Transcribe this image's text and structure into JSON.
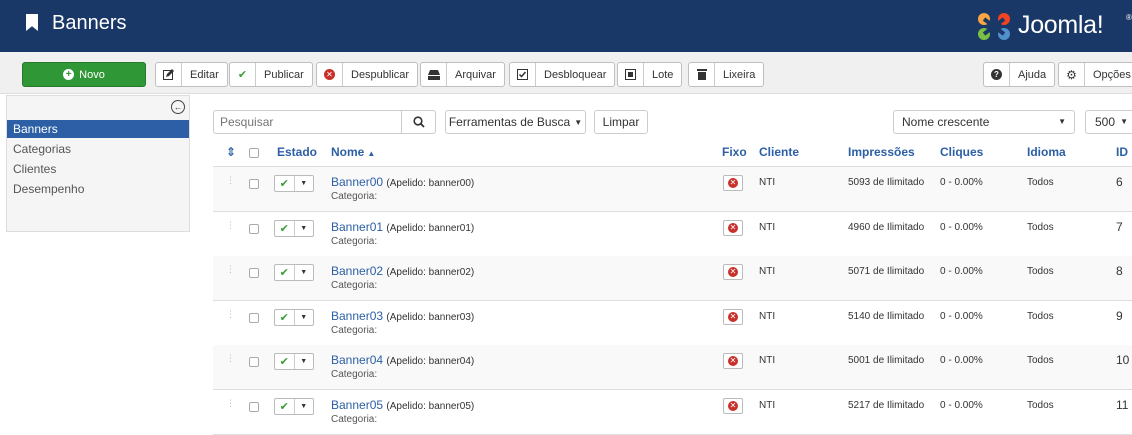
{
  "header": {
    "title": "Banners",
    "logo_text": "Joomla!",
    "logo_reg": "®"
  },
  "toolbar": {
    "new_label": "Novo",
    "edit_label": "Editar",
    "publish_label": "Publicar",
    "unpublish_label": "Despublicar",
    "archive_label": "Arquivar",
    "checkin_label": "Desbloquear",
    "batch_label": "Lote",
    "trash_label": "Lixeira",
    "help_label": "Ajuda",
    "options_label": "Opções"
  },
  "sidebar": {
    "items": [
      "Banners",
      "Categorias",
      "Clientes",
      "Desempenho"
    ],
    "active": "Banners"
  },
  "filters": {
    "search_placeholder": "Pesquisar",
    "search_tools_label": "Ferramentas de Busca",
    "clear_label": "Limpar",
    "sort_value": "Nome crescente",
    "limit_value": "500"
  },
  "table": {
    "headers": {
      "ordering": "⇕",
      "state": "Estado",
      "name": "Nome",
      "pinned": "Fixo",
      "client": "Cliente",
      "impressions": "Impressões",
      "clicks": "Cliques",
      "language": "Idioma",
      "id": "ID"
    },
    "rows": [
      {
        "name": "Banner00",
        "alias": "(Apelido: banner00)",
        "category": "Categoria:",
        "client": "NTI",
        "impressions": "5093 de Ilimitado",
        "clicks": "0 - 0.00%",
        "language": "Todos",
        "id": "6"
      },
      {
        "name": "Banner01",
        "alias": "(Apelido: banner01)",
        "category": "Categoria:",
        "client": "NTI",
        "impressions": "4960 de Ilimitado",
        "clicks": "0 - 0.00%",
        "language": "Todos",
        "id": "7"
      },
      {
        "name": "Banner02",
        "alias": "(Apelido: banner02)",
        "category": "Categoria:",
        "client": "NTI",
        "impressions": "5071 de Ilimitado",
        "clicks": "0 - 0.00%",
        "language": "Todos",
        "id": "8"
      },
      {
        "name": "Banner03",
        "alias": "(Apelido: banner03)",
        "category": "Categoria:",
        "client": "NTI",
        "impressions": "5140 de Ilimitado",
        "clicks": "0 - 0.00%",
        "language": "Todos",
        "id": "9"
      },
      {
        "name": "Banner04",
        "alias": "(Apelido: banner04)",
        "category": "Categoria:",
        "client": "NTI",
        "impressions": "5001 de Ilimitado",
        "clicks": "0 - 0.00%",
        "language": "Todos",
        "id": "10"
      },
      {
        "name": "Banner05",
        "alias": "(Apelido: banner05)",
        "category": "Categoria:",
        "client": "NTI",
        "impressions": "5217 de Ilimitado",
        "clicks": "0 - 0.00%",
        "language": "Todos",
        "id": "11"
      }
    ]
  },
  "colors": {
    "header_bg": "#1a3867",
    "new_button": "#2f9736",
    "link": "#2c5fa5",
    "unpin_icon": "#c8302a"
  }
}
